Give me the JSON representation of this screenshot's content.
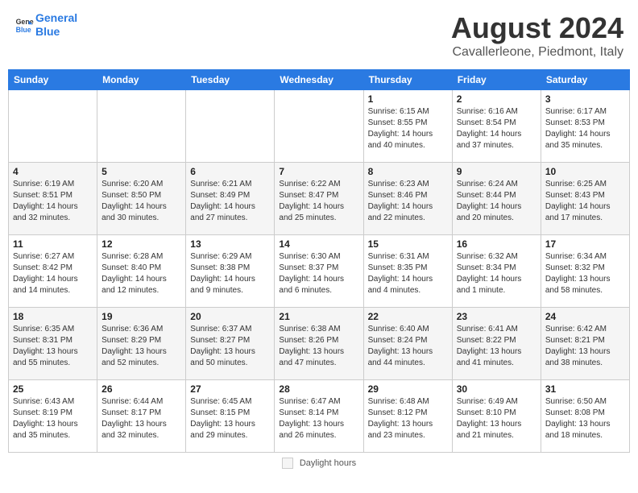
{
  "header": {
    "logo_line1": "General",
    "logo_line2": "Blue",
    "main_title": "August 2024",
    "sub_title": "Cavallerleone, Piedmont, Italy"
  },
  "days_of_week": [
    "Sunday",
    "Monday",
    "Tuesday",
    "Wednesday",
    "Thursday",
    "Friday",
    "Saturday"
  ],
  "weeks": [
    [
      {
        "num": "",
        "info": ""
      },
      {
        "num": "",
        "info": ""
      },
      {
        "num": "",
        "info": ""
      },
      {
        "num": "",
        "info": ""
      },
      {
        "num": "1",
        "info": "Sunrise: 6:15 AM\nSunset: 8:55 PM\nDaylight: 14 hours and 40 minutes."
      },
      {
        "num": "2",
        "info": "Sunrise: 6:16 AM\nSunset: 8:54 PM\nDaylight: 14 hours and 37 minutes."
      },
      {
        "num": "3",
        "info": "Sunrise: 6:17 AM\nSunset: 8:53 PM\nDaylight: 14 hours and 35 minutes."
      }
    ],
    [
      {
        "num": "4",
        "info": "Sunrise: 6:19 AM\nSunset: 8:51 PM\nDaylight: 14 hours and 32 minutes."
      },
      {
        "num": "5",
        "info": "Sunrise: 6:20 AM\nSunset: 8:50 PM\nDaylight: 14 hours and 30 minutes."
      },
      {
        "num": "6",
        "info": "Sunrise: 6:21 AM\nSunset: 8:49 PM\nDaylight: 14 hours and 27 minutes."
      },
      {
        "num": "7",
        "info": "Sunrise: 6:22 AM\nSunset: 8:47 PM\nDaylight: 14 hours and 25 minutes."
      },
      {
        "num": "8",
        "info": "Sunrise: 6:23 AM\nSunset: 8:46 PM\nDaylight: 14 hours and 22 minutes."
      },
      {
        "num": "9",
        "info": "Sunrise: 6:24 AM\nSunset: 8:44 PM\nDaylight: 14 hours and 20 minutes."
      },
      {
        "num": "10",
        "info": "Sunrise: 6:25 AM\nSunset: 8:43 PM\nDaylight: 14 hours and 17 minutes."
      }
    ],
    [
      {
        "num": "11",
        "info": "Sunrise: 6:27 AM\nSunset: 8:42 PM\nDaylight: 14 hours and 14 minutes."
      },
      {
        "num": "12",
        "info": "Sunrise: 6:28 AM\nSunset: 8:40 PM\nDaylight: 14 hours and 12 minutes."
      },
      {
        "num": "13",
        "info": "Sunrise: 6:29 AM\nSunset: 8:38 PM\nDaylight: 14 hours and 9 minutes."
      },
      {
        "num": "14",
        "info": "Sunrise: 6:30 AM\nSunset: 8:37 PM\nDaylight: 14 hours and 6 minutes."
      },
      {
        "num": "15",
        "info": "Sunrise: 6:31 AM\nSunset: 8:35 PM\nDaylight: 14 hours and 4 minutes."
      },
      {
        "num": "16",
        "info": "Sunrise: 6:32 AM\nSunset: 8:34 PM\nDaylight: 14 hours and 1 minute."
      },
      {
        "num": "17",
        "info": "Sunrise: 6:34 AM\nSunset: 8:32 PM\nDaylight: 13 hours and 58 minutes."
      }
    ],
    [
      {
        "num": "18",
        "info": "Sunrise: 6:35 AM\nSunset: 8:31 PM\nDaylight: 13 hours and 55 minutes."
      },
      {
        "num": "19",
        "info": "Sunrise: 6:36 AM\nSunset: 8:29 PM\nDaylight: 13 hours and 52 minutes."
      },
      {
        "num": "20",
        "info": "Sunrise: 6:37 AM\nSunset: 8:27 PM\nDaylight: 13 hours and 50 minutes."
      },
      {
        "num": "21",
        "info": "Sunrise: 6:38 AM\nSunset: 8:26 PM\nDaylight: 13 hours and 47 minutes."
      },
      {
        "num": "22",
        "info": "Sunrise: 6:40 AM\nSunset: 8:24 PM\nDaylight: 13 hours and 44 minutes."
      },
      {
        "num": "23",
        "info": "Sunrise: 6:41 AM\nSunset: 8:22 PM\nDaylight: 13 hours and 41 minutes."
      },
      {
        "num": "24",
        "info": "Sunrise: 6:42 AM\nSunset: 8:21 PM\nDaylight: 13 hours and 38 minutes."
      }
    ],
    [
      {
        "num": "25",
        "info": "Sunrise: 6:43 AM\nSunset: 8:19 PM\nDaylight: 13 hours and 35 minutes."
      },
      {
        "num": "26",
        "info": "Sunrise: 6:44 AM\nSunset: 8:17 PM\nDaylight: 13 hours and 32 minutes."
      },
      {
        "num": "27",
        "info": "Sunrise: 6:45 AM\nSunset: 8:15 PM\nDaylight: 13 hours and 29 minutes."
      },
      {
        "num": "28",
        "info": "Sunrise: 6:47 AM\nSunset: 8:14 PM\nDaylight: 13 hours and 26 minutes."
      },
      {
        "num": "29",
        "info": "Sunrise: 6:48 AM\nSunset: 8:12 PM\nDaylight: 13 hours and 23 minutes."
      },
      {
        "num": "30",
        "info": "Sunrise: 6:49 AM\nSunset: 8:10 PM\nDaylight: 13 hours and 21 minutes."
      },
      {
        "num": "31",
        "info": "Sunrise: 6:50 AM\nSunset: 8:08 PM\nDaylight: 13 hours and 18 minutes."
      }
    ]
  ],
  "footer": {
    "legend_label": "Daylight hours"
  }
}
